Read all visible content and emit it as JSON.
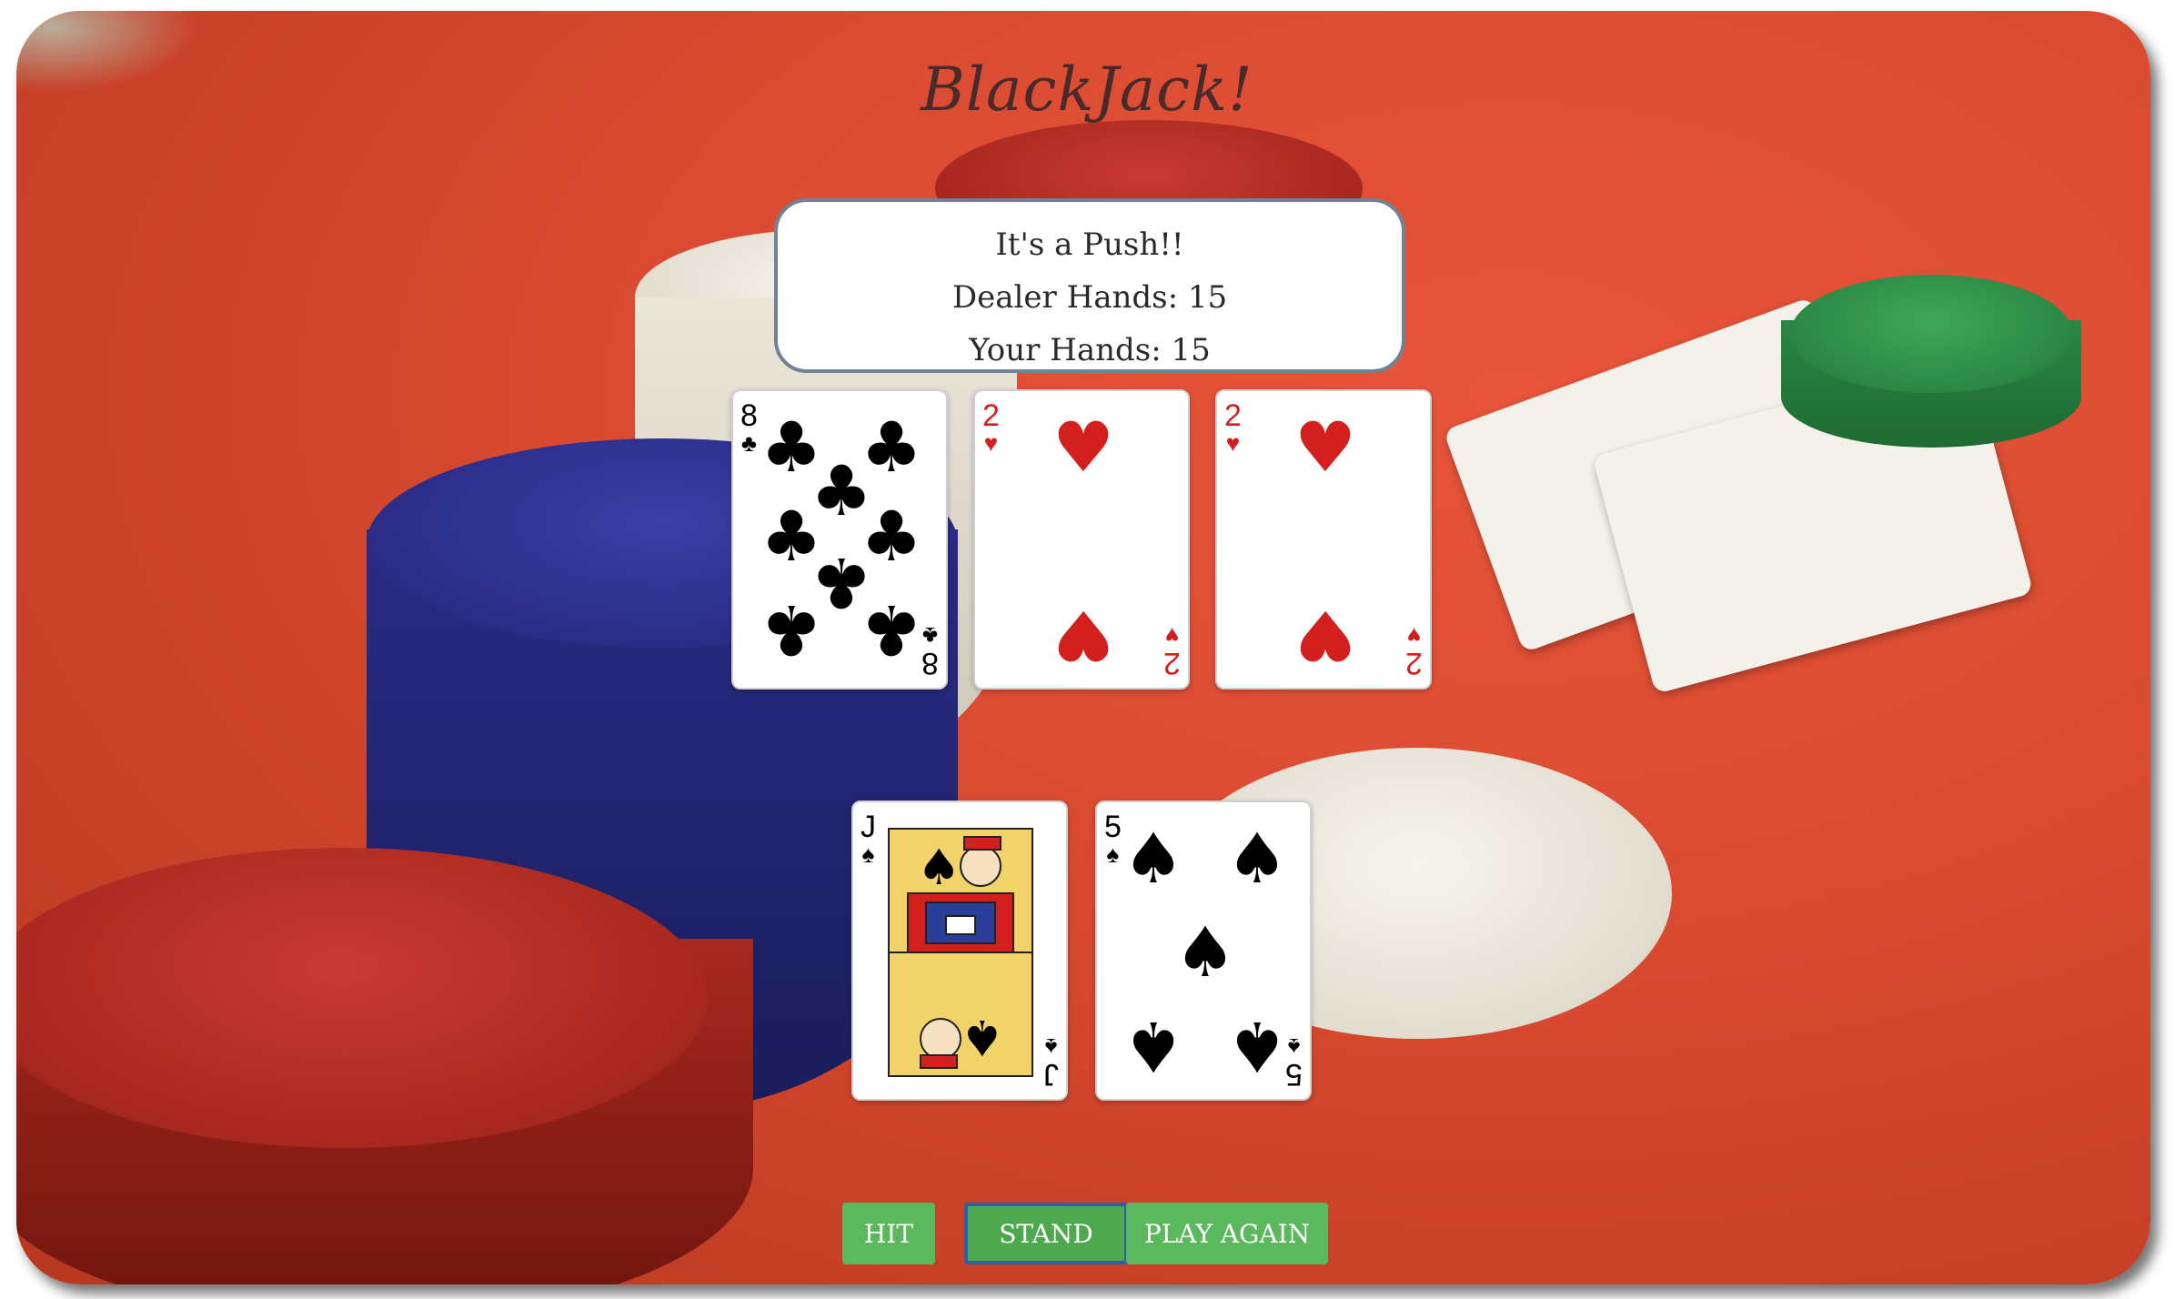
{
  "title": "BlackJack!",
  "status": {
    "message": "It's a Push!!",
    "dealer_hands": "Dealer Hands: 15",
    "your_hands": "Your Hands: 15"
  },
  "dealer_cards": [
    {
      "rank": "8",
      "suit": "♣",
      "color": "#000000"
    },
    {
      "rank": "2",
      "suit": "♥",
      "color": "#d41f1f"
    },
    {
      "rank": "2",
      "suit": "♥",
      "color": "#d41f1f"
    }
  ],
  "player_cards": [
    {
      "rank": "J",
      "suit": "♠",
      "color": "#000000"
    },
    {
      "rank": "5",
      "suit": "♠",
      "color": "#000000"
    }
  ],
  "buttons": {
    "hit": "HIT",
    "stand": "STAND",
    "play_again": "PLAY AGAIN"
  },
  "colors": {
    "button": "#5cb85c",
    "focus_ring": "#2f5fa8",
    "status_border": "#6f8297",
    "title": "#4a2a2a"
  }
}
